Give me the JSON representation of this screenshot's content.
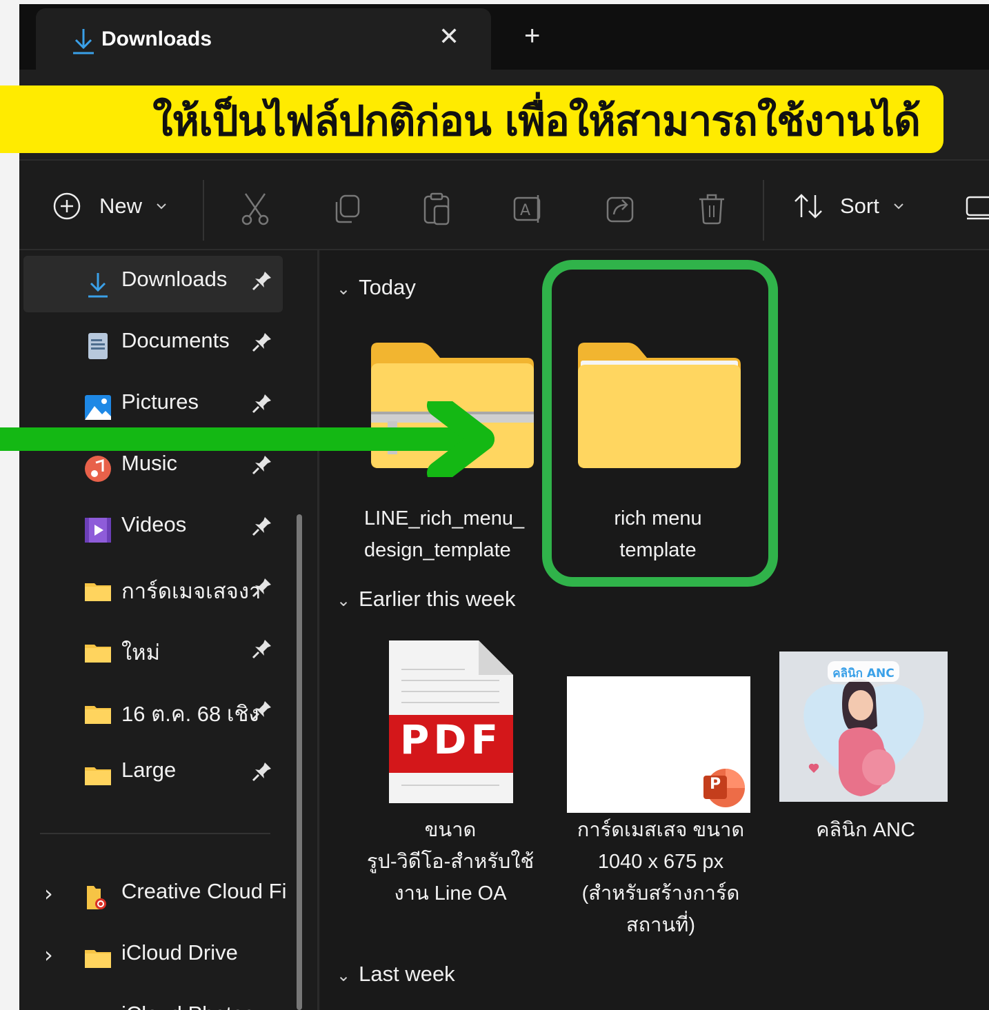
{
  "tab": {
    "title": "Downloads",
    "close": "✕",
    "new_tab": "+"
  },
  "banner": {
    "text": "ให้เป็นไฟล์ปกติก่อน เพื่อให้สามารถใช้งานได้"
  },
  "toolbar": {
    "new_label": "New",
    "sort_label": "Sort"
  },
  "sidebar": {
    "items": [
      {
        "label": "Downloads"
      },
      {
        "label": "Documents"
      },
      {
        "label": "Pictures"
      },
      {
        "label": "Music"
      },
      {
        "label": "Videos"
      },
      {
        "label": "การ์ดเมจเสจงาน"
      },
      {
        "label": "ใหม่"
      },
      {
        "label": "16 ต.ค. 68 เชิง"
      },
      {
        "label": "Large"
      },
      {
        "label": "Creative Cloud Files"
      },
      {
        "label": "iCloud Drive"
      },
      {
        "label": "iCloud Photos"
      }
    ]
  },
  "groups": {
    "today": "Today",
    "earlier": "Earlier this week",
    "last_week": "Last week"
  },
  "files": {
    "zip": {
      "line1": "LINE_rich_menu_",
      "line2": "design_template"
    },
    "folder": {
      "line1": "rich menu",
      "line2": "template"
    },
    "pdf": {
      "line1": "ขนาด",
      "line2": "รูป-วิดีโอ-สำหรับใช้",
      "line3": "งาน Line OA",
      "badge": "PDF"
    },
    "pptx": {
      "line1": "การ์ดเมสเสจ ขนาด",
      "line2": "1040 x 675 px",
      "line3": "(สำหรับสร้างการ์ด",
      "line4": "สถานที่)",
      "badge": "P"
    },
    "image": {
      "line1": "คลินิก ANC",
      "thumb_label": "คลินิก ANC"
    }
  },
  "colors": {
    "banner": "#ffeb00",
    "highlight": "#30b34a",
    "arrow": "#14b814"
  }
}
